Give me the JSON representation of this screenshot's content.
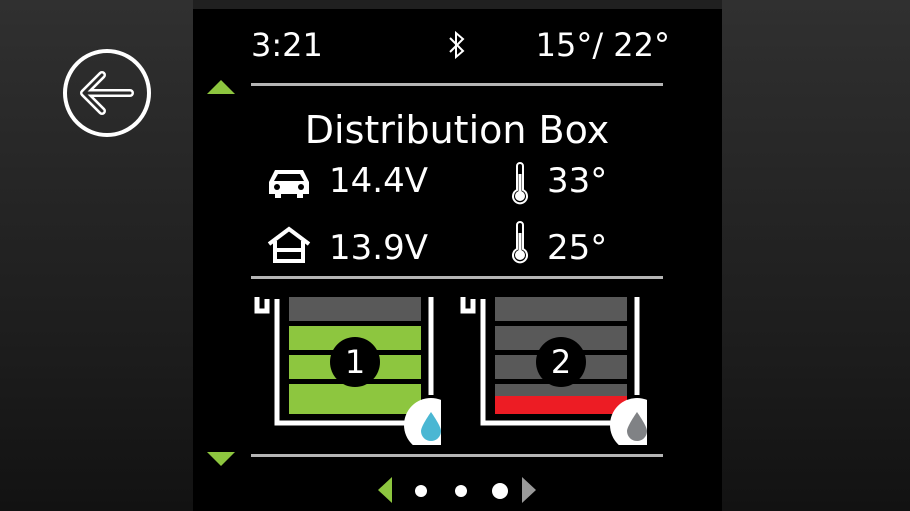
{
  "status_bar": {
    "time": "3:21",
    "bluetooth_icon": "bluetooth-icon",
    "temperatures": "15°/ 22°"
  },
  "title": "Distribution Box",
  "readings": {
    "vehicle_voltage": "14.4V",
    "vehicle_temp": "33°",
    "house_voltage": "13.9V",
    "house_temp": "25°"
  },
  "tanks": [
    {
      "number": "1",
      "level_bars_filled": 4,
      "total_bars": 5,
      "fill_color": "#8dc63f",
      "drop_color": "#4ab7d3"
    },
    {
      "number": "2",
      "level_bars_filled": 1,
      "total_bars": 5,
      "fill_color": "#ed1c24",
      "drop_color": "#808285"
    }
  ],
  "pager": {
    "pages": 3,
    "current": 3
  },
  "colors": {
    "accent": "#8dc63f",
    "divider": "#b5b5b5",
    "empty_bar": "#595959"
  }
}
